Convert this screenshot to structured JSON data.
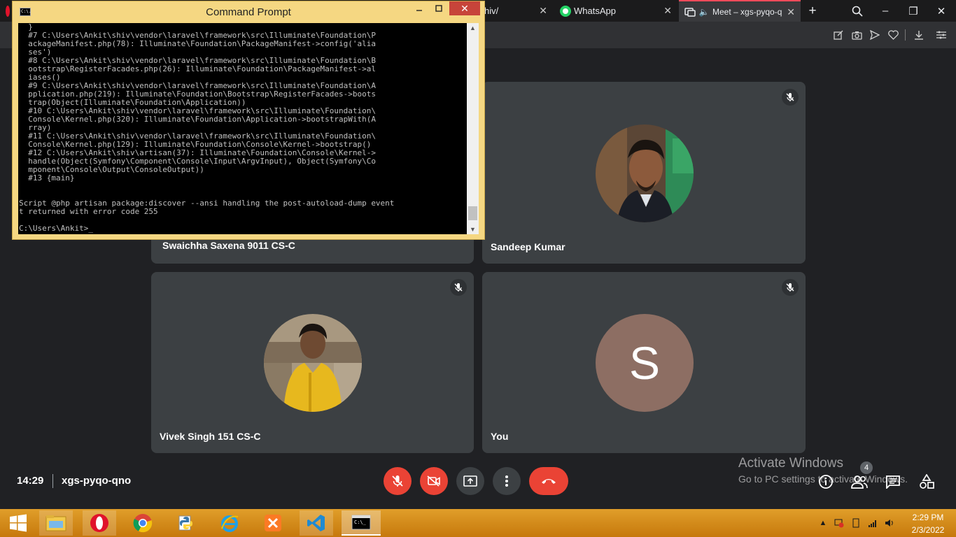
{
  "browser": {
    "tabs": [
      {
        "title": "hiv/",
        "active": false
      },
      {
        "title": "WhatsApp",
        "active": false
      },
      {
        "title": "Meet – xgs-pyqo-q",
        "active": true
      }
    ],
    "new_tab": "+",
    "search_icon": "search-icon",
    "win_min": "–",
    "win_restore": "❐",
    "win_close": "✕"
  },
  "meet": {
    "tiles": [
      {
        "name": "Swaichha Saxena 9011 CS-C",
        "avatar": "hidden-behind-window",
        "muted": true
      },
      {
        "name": "Sandeep Kumar",
        "avatar": "photo",
        "muted": true
      },
      {
        "name": "Vivek Singh 151 CS-C",
        "avatar": "photo",
        "muted": true
      },
      {
        "name": "You",
        "avatar_letter": "S",
        "avatar_color": "#8d6e63",
        "muted": true
      }
    ],
    "time": "14:29",
    "meeting_code": "xgs-pyqo-qno",
    "people_count": "4",
    "controls": [
      "mic-off",
      "camera-off",
      "present",
      "more-options",
      "hang-up"
    ],
    "activate_line1": "Activate Windows",
    "activate_line2": "Go to PC settings to activate Windows."
  },
  "cmd": {
    "title": "Command Prompt",
    "icon_text": "C:\\.",
    "lines": [
      "  }",
      "  #7 C:\\Users\\Ankit\\shiv\\vendor\\laravel\\framework\\src\\Illuminate\\Foundation\\P",
      "  ackageManifest.php(78): Illuminate\\Foundation\\PackageManifest->config('alia",
      "  ses')",
      "  #8 C:\\Users\\Ankit\\shiv\\vendor\\laravel\\framework\\src\\Illuminate\\Foundation\\B",
      "  ootstrap\\RegisterFacades.php(26): Illuminate\\Foundation\\PackageManifest->al",
      "  iases()",
      "  #9 C:\\Users\\Ankit\\shiv\\vendor\\laravel\\framework\\src\\Illuminate\\Foundation\\A",
      "  pplication.php(219): Illuminate\\Foundation\\Bootstrap\\RegisterFacades->boots",
      "  trap(Object(Illuminate\\Foundation\\Application))",
      "  #10 C:\\Users\\Ankit\\shiv\\vendor\\laravel\\framework\\src\\Illuminate\\Foundation\\",
      "  Console\\Kernel.php(320): Illuminate\\Foundation\\Application->bootstrapWith(A",
      "  rray)",
      "  #11 C:\\Users\\Ankit\\shiv\\vendor\\laravel\\framework\\src\\Illuminate\\Foundation\\",
      "  Console\\Kernel.php(129): Illuminate\\Foundation\\Console\\Kernel->bootstrap()",
      "  #12 C:\\Users\\Ankit\\shiv\\artisan(37): Illuminate\\Foundation\\Console\\Kernel->",
      "  handle(Object(Symfony\\Component\\Console\\Input\\ArgvInput), Object(Symfony\\Co",
      "  mponent\\Console\\Output\\ConsoleOutput))",
      "  #13 {main}",
      "",
      "",
      "Script @php artisan package:discover --ansi handling the post-autoload-dump event",
      "t returned with error code 255",
      "",
      "C:\\Users\\Ankit>_"
    ]
  },
  "taskbar": {
    "apps": [
      "start",
      "file-explorer",
      "opera",
      "chrome",
      "python",
      "internet-explorer",
      "xampp",
      "vscode",
      "command-prompt"
    ],
    "clock_time": "2:29 PM",
    "clock_date": "2/3/2022"
  }
}
